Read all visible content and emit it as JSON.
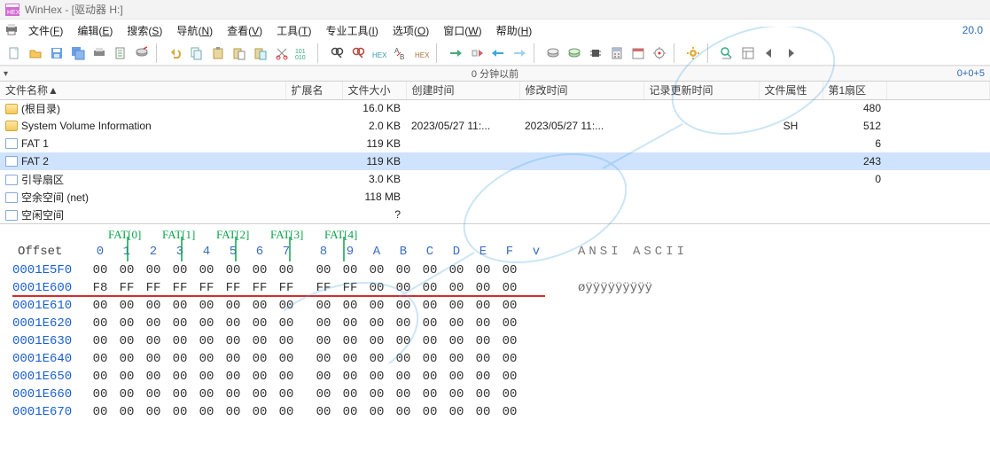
{
  "title": "WinHex - [驱动器 H:]",
  "version": "20.0",
  "menus": {
    "file": {
      "t": "文件",
      "k": "F"
    },
    "edit": {
      "t": "编辑",
      "k": "E"
    },
    "search": {
      "t": "搜索",
      "k": "S"
    },
    "nav": {
      "t": "导航",
      "k": "N"
    },
    "view": {
      "t": "查看",
      "k": "V"
    },
    "tool": {
      "t": "工具",
      "k": "T"
    },
    "pro": {
      "t": "专业工具",
      "k": "I"
    },
    "opt": {
      "t": "选项",
      "k": "O"
    },
    "win": {
      "t": "窗口",
      "k": "W"
    },
    "help": {
      "t": "帮助",
      "k": "H"
    }
  },
  "timestrip": {
    "center": "0 分钟以前",
    "right": "0+0+5"
  },
  "columns": {
    "name": "文件名称▲",
    "ext": "扩展名",
    "size": "文件大小",
    "ctime": "创建时间",
    "mtime": "修改时间",
    "rtime": "记录更新时间",
    "attr": "文件属性",
    "sector": "第1扇区"
  },
  "rows": [
    {
      "icon": "folder",
      "name": "(根目录)",
      "ext": "",
      "size": "16.0 KB",
      "ctime": "",
      "mtime": "",
      "rtime": "",
      "attr": "",
      "sector": "480"
    },
    {
      "icon": "folder",
      "name": "System Volume Information",
      "ext": "",
      "size": "2.0 KB",
      "ctime": "2023/05/27  11:...",
      "mtime": "2023/05/27  11:...",
      "rtime": "",
      "attr": "SH",
      "sector": "512"
    },
    {
      "icon": "file",
      "name": "FAT 1",
      "ext": "",
      "size": "119 KB",
      "ctime": "",
      "mtime": "",
      "rtime": "",
      "attr": "",
      "sector": "6"
    },
    {
      "icon": "file",
      "name": "FAT 2",
      "ext": "",
      "size": "119 KB",
      "ctime": "",
      "mtime": "",
      "rtime": "",
      "attr": "",
      "sector": "243",
      "sel": true
    },
    {
      "icon": "file",
      "name": "引导扇区",
      "ext": "",
      "size": "3.0 KB",
      "ctime": "",
      "mtime": "",
      "rtime": "",
      "attr": "",
      "sector": "0"
    },
    {
      "icon": "file",
      "name": "空余空间 (net)",
      "ext": "",
      "size": "118 MB",
      "ctime": "",
      "mtime": "",
      "rtime": "",
      "attr": "",
      "sector": ""
    },
    {
      "icon": "file",
      "name": "空闲空间",
      "ext": "",
      "size": "?",
      "ctime": "",
      "mtime": "",
      "rtime": "",
      "attr": "",
      "sector": ""
    }
  ],
  "fat_labels": [
    "FAT[0]",
    "FAT[1]",
    "FAT[2]",
    "FAT[3]",
    "FAT[4]"
  ],
  "hex": {
    "offset_label": "Offset",
    "cols": [
      "0",
      "1",
      "2",
      "3",
      "4",
      "5",
      "6",
      "7",
      "8",
      "9",
      "A",
      "B",
      "C",
      "D",
      "E",
      "F"
    ],
    "vcol": "v",
    "ascii_label": "ANSI ASCII",
    "rows": [
      {
        "off": "0001E5F0",
        "b": [
          "00",
          "00",
          "00",
          "00",
          "00",
          "00",
          "00",
          "00",
          "00",
          "00",
          "00",
          "00",
          "00",
          "00",
          "00",
          "00"
        ],
        "asc": ""
      },
      {
        "off": "0001E600",
        "b": [
          "F8",
          "FF",
          "FF",
          "FF",
          "FF",
          "FF",
          "FF",
          "FF",
          "FF",
          "FF",
          "00",
          "00",
          "00",
          "00",
          "00",
          "00"
        ],
        "asc": "øÿÿÿÿÿÿÿÿÿ"
      },
      {
        "off": "0001E610",
        "b": [
          "00",
          "00",
          "00",
          "00",
          "00",
          "00",
          "00",
          "00",
          "00",
          "00",
          "00",
          "00",
          "00",
          "00",
          "00",
          "00"
        ],
        "asc": ""
      },
      {
        "off": "0001E620",
        "b": [
          "00",
          "00",
          "00",
          "00",
          "00",
          "00",
          "00",
          "00",
          "00",
          "00",
          "00",
          "00",
          "00",
          "00",
          "00",
          "00"
        ],
        "asc": ""
      },
      {
        "off": "0001E630",
        "b": [
          "00",
          "00",
          "00",
          "00",
          "00",
          "00",
          "00",
          "00",
          "00",
          "00",
          "00",
          "00",
          "00",
          "00",
          "00",
          "00"
        ],
        "asc": ""
      },
      {
        "off": "0001E640",
        "b": [
          "00",
          "00",
          "00",
          "00",
          "00",
          "00",
          "00",
          "00",
          "00",
          "00",
          "00",
          "00",
          "00",
          "00",
          "00",
          "00"
        ],
        "asc": ""
      },
      {
        "off": "0001E650",
        "b": [
          "00",
          "00",
          "00",
          "00",
          "00",
          "00",
          "00",
          "00",
          "00",
          "00",
          "00",
          "00",
          "00",
          "00",
          "00",
          "00"
        ],
        "asc": ""
      },
      {
        "off": "0001E660",
        "b": [
          "00",
          "00",
          "00",
          "00",
          "00",
          "00",
          "00",
          "00",
          "00",
          "00",
          "00",
          "00",
          "00",
          "00",
          "00",
          "00"
        ],
        "asc": ""
      },
      {
        "off": "0001E670",
        "b": [
          "00",
          "00",
          "00",
          "00",
          "00",
          "00",
          "00",
          "00",
          "00",
          "00",
          "00",
          "00",
          "00",
          "00",
          "00",
          "00"
        ],
        "asc": ""
      }
    ]
  }
}
